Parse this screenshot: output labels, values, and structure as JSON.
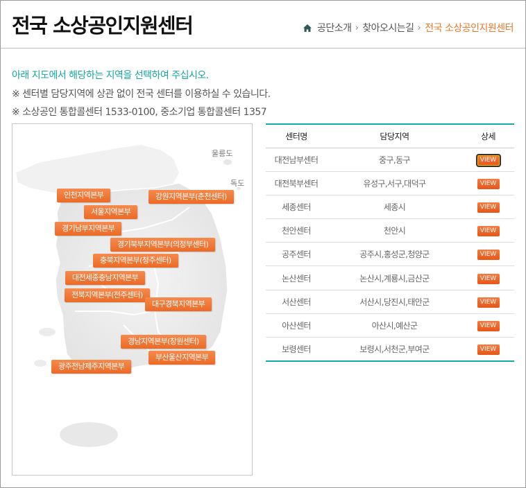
{
  "header": {
    "title": "전국 소상공인지원센터",
    "breadcrumb": [
      "공단소개",
      "찾아오시는길",
      "전국 소상공인지원센터"
    ]
  },
  "notices": [
    "아래 지도에서 해당하는 지역을 선택하여 주십시오.",
    "※ 센터별 담당지역에 상관 없이 전국 센터를 이용하실 수 있습니다.",
    "※ 소상공인 통합콜센터 1533-0100, 중소기업 통합콜센터 1357"
  ],
  "map": {
    "islands": [
      "울릉도",
      "독도"
    ],
    "regions": [
      "인천지역본부",
      "강원지역본부(춘천센터)",
      "서울지역본부",
      "경기남부지역본부",
      "경기북부지역본부(의정부센터)",
      "충북지역본부(청주센터)",
      "대전세종충남지역본부",
      "전북지역본부(전주센터)",
      "대구경북지역본부",
      "경남지역본부(창원센터)",
      "부산울산지역본부",
      "광주전남제주지역본부"
    ]
  },
  "table": {
    "headers": [
      "센터명",
      "담당지역",
      "상세"
    ],
    "view_label": "VIEW",
    "rows": [
      {
        "center": "대전남부센터",
        "area": "중구,동구"
      },
      {
        "center": "대전북부센터",
        "area": "유성구,서구,대덕구"
      },
      {
        "center": "세종센터",
        "area": "세종시"
      },
      {
        "center": "천안센터",
        "area": "천안시"
      },
      {
        "center": "공주센터",
        "area": "공주시,홍성군,청양군"
      },
      {
        "center": "논산센터",
        "area": "논산시,계룡시,금산군"
      },
      {
        "center": "서산센터",
        "area": "서산시,당진시,태안군"
      },
      {
        "center": "아산센터",
        "area": "아산시,예산군"
      },
      {
        "center": "보령센터",
        "area": "보령시,서천군,부여군"
      }
    ]
  },
  "colors": {
    "accent": "#16a6a2",
    "orange": "#e8792b",
    "button": "#ec6a26"
  }
}
